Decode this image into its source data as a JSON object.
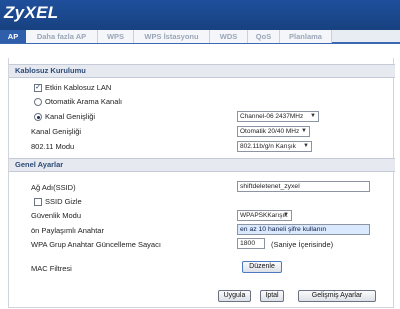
{
  "brand": {
    "logo": "ZyXEL"
  },
  "tabs": [
    "AP",
    "Daha fazla AP",
    "WPS",
    "WPS İstasyonu",
    "WDS",
    "QoS",
    "Planlama"
  ],
  "sections": {
    "wireless_setup": "Kablosuz Kurulumu",
    "general_settings": "Genel Ayarlar"
  },
  "wireless": {
    "enable_lan": {
      "label": "Etkin Kablosuz LAN",
      "checked": true
    },
    "auto_channel": {
      "label": "Otomatik Arama Kanalı",
      "selected": false
    },
    "channel": {
      "label": "Kanal Genişliği",
      "selected": true,
      "value": "Channel-06 2437MHz"
    },
    "channel_width": {
      "label": "Kanal Genişliği",
      "value": "Otomatik 20/40 MHz"
    },
    "mode": {
      "label": "802.11 Modu",
      "value": "802.11b/g/n Karışık"
    }
  },
  "general": {
    "ssid": {
      "label": "Ağ Adı(SSID)",
      "value": "shiftdeletenet_zyxel"
    },
    "hide_ssid": {
      "label": "SSID Gizle",
      "checked": false
    },
    "security_mode": {
      "label": "Güvenlik Modu",
      "value": "WPAPSKKarışık"
    },
    "psk": {
      "label": "ön Paylaşımlı Anahtar",
      "value": "en az 10 haneli şifre kullanın"
    },
    "wpa_group_key": {
      "label": "WPA Grup Anahtar Güncelleme Sayacı",
      "value": "1800",
      "unit": "(Saniye İçerisinde)"
    },
    "mac_filter": {
      "label": "MAC Filtresi",
      "button": "Düzenle"
    }
  },
  "actions": {
    "apply": "Uygula",
    "cancel": "İptal",
    "advanced": "Gelişmiş Ayarlar"
  }
}
